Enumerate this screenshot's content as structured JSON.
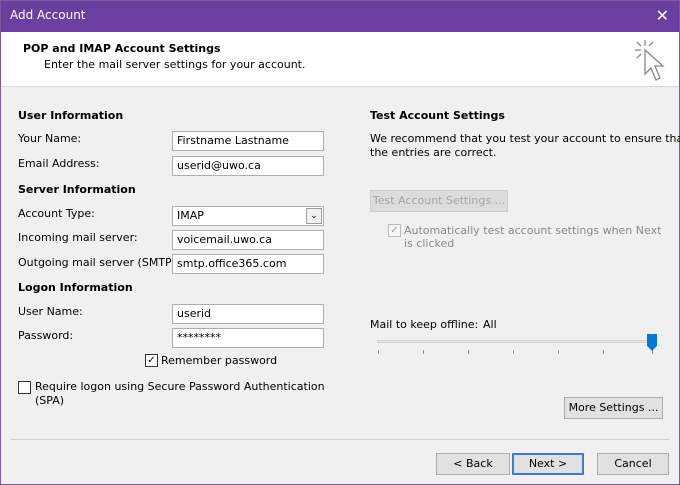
{
  "window": {
    "title": "Add Account"
  },
  "header": {
    "title": "POP and IMAP Account Settings",
    "subtitle": "Enter the mail server settings for your account."
  },
  "user_info": {
    "heading": "User Information",
    "your_name_label": "Your Name:",
    "your_name_value": "Firstname Lastname",
    "email_label": "Email Address:",
    "email_value": "userid@uwo.ca"
  },
  "server_info": {
    "heading": "Server Information",
    "account_type_label": "Account Type:",
    "account_type_value": "IMAP",
    "incoming_label": "Incoming mail server:",
    "incoming_value": "voicemail.uwo.ca",
    "outgoing_label": "Outgoing mail server (SMTP):",
    "outgoing_value": "smtp.office365.com"
  },
  "logon_info": {
    "heading": "Logon Information",
    "username_label": "User Name:",
    "username_value": "userid",
    "password_label": "Password:",
    "password_value": "********",
    "remember_label": "Remember password",
    "remember_checked": true,
    "spa_label_line1": "Require logon using Secure Password Authentication",
    "spa_label_line2": "(SPA)",
    "spa_checked": false
  },
  "test_settings": {
    "heading": "Test Account Settings",
    "description_line1": "We recommend that you test your account to ensure that",
    "description_line2": "the entries are correct.",
    "test_button": "Test Account Settings ...",
    "auto_test_line1": "Automatically test account settings when Next",
    "auto_test_line2": "is clicked",
    "auto_test_checked": true
  },
  "offline": {
    "label": "Mail to keep offline:",
    "value": "All",
    "slider_fraction": 1.0
  },
  "buttons": {
    "more_settings": "More Settings ...",
    "back": "< Back",
    "next": "Next >",
    "cancel": "Cancel"
  },
  "icons": {
    "close": "close-icon",
    "header": "cursor-click-icon",
    "dropdown": "chevron-down-icon",
    "check": "checkmark-icon"
  },
  "colors": {
    "titlebar": "#6b3fa0",
    "slider": "#0078d7",
    "primary_border": "#3d7bd4"
  }
}
